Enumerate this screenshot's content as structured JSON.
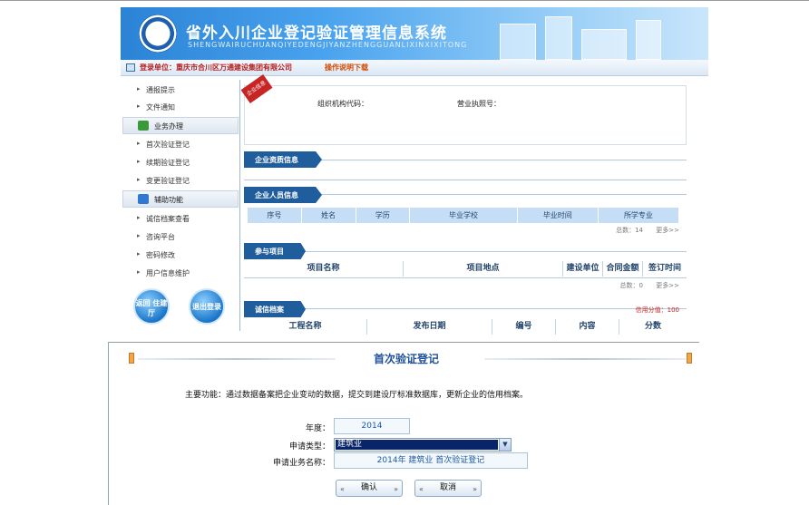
{
  "banner": {
    "title": "省外入川企业登记验证管理信息系统",
    "subtitle": "SHENGWAIRUCHUANQIYEDENGJIYANZHENGGUANLIXINXIXITONG"
  },
  "login": {
    "unit_label": "登录单位：重庆市合川区万通建设集团有限公司",
    "help_link": "操作说明下载"
  },
  "sidebar": {
    "items_top": [
      "通报提示",
      "文件通知"
    ],
    "section_business": "业务办理",
    "items_business": [
      "首次验证登记",
      "续期验证登记",
      "变更验证登记"
    ],
    "section_aux": "辅助功能",
    "items_aux": [
      "诚信档案查看",
      "咨询平台",
      "密码修改",
      "用户信息维护"
    ],
    "btn_return": "返回 住建厅",
    "btn_logout": "退出登录"
  },
  "main": {
    "ribbon": "企业信息",
    "org_code_label": "组织机构代码：",
    "license_label": "营业执照号：",
    "sec_qualification": "企业资质信息",
    "sec_personnel": "企业人员信息",
    "personnel_cols": [
      "序号",
      "姓名",
      "学历",
      "毕业学校",
      "毕业时间",
      "所学专业"
    ],
    "personnel_total": "总数：14",
    "more1": "更多>>",
    "sec_projects": "参与项目",
    "project_cols": [
      "项目名称",
      "项目地点",
      "建设单位",
      "合同金额",
      "签订时间"
    ],
    "project_total": "总数：0",
    "more2": "更多>>",
    "sec_credit": "诚信档案",
    "credit_score": "信用分值：100",
    "credit_cols": [
      "工程名称",
      "发布日期",
      "编号",
      "内容",
      "分数"
    ]
  },
  "form": {
    "title": "首次验证登记",
    "description": "主要功能：通过数据备案把企业变动的数据，提交到建设厅标准数据库，更新企业的信用档案。",
    "year_label": "年度：",
    "year_value": "2014",
    "type_label": "申请类型：",
    "type_value": "建筑业",
    "name_label": "申请业务名称：",
    "name_value": "2014年 建筑业 首次验证登记",
    "confirm": "确认",
    "cancel": "取消"
  }
}
